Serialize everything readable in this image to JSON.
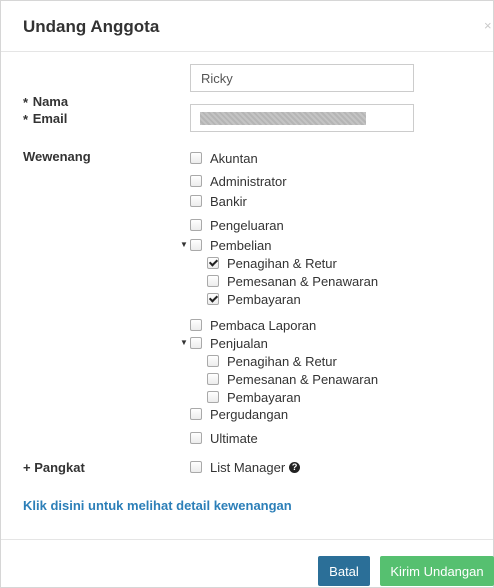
{
  "modal": {
    "title": "Undang Anggota",
    "close_glyph": "×"
  },
  "form": {
    "name_label": "Nama",
    "name_value": "Ricky",
    "email_label": "Email",
    "email_value_redacted": true,
    "required_mark": "*",
    "permissions_label": "Wewenang",
    "rank_label": "+ Pangkat"
  },
  "permissions": [
    {
      "label": "Akuntan",
      "checked": false
    },
    {
      "label": "Administrator",
      "checked": false
    },
    {
      "label": "Bankir",
      "checked": false
    },
    {
      "label": "Pengeluaran",
      "checked": false
    },
    {
      "label": "Pembelian",
      "checked": false,
      "expanded": true,
      "children": [
        {
          "label": "Penagihan & Retur",
          "checked": true
        },
        {
          "label": "Pemesanan & Penawaran",
          "checked": false
        },
        {
          "label": "Pembayaran",
          "checked": true
        }
      ]
    },
    {
      "label": "Pembaca Laporan",
      "checked": false
    },
    {
      "label": "Penjualan",
      "checked": false,
      "expanded": true,
      "children": [
        {
          "label": "Penagihan & Retur",
          "checked": false
        },
        {
          "label": "Pemesanan & Penawaran",
          "checked": false
        },
        {
          "label": "Pembayaran",
          "checked": false
        }
      ]
    },
    {
      "label": "Pergudangan",
      "checked": false
    },
    {
      "label": "Ultimate",
      "checked": false
    }
  ],
  "rank": {
    "option_label": "List Manager",
    "checked": false,
    "help_icon": "question-circle-icon"
  },
  "links": {
    "detail": "Klik disini untuk melihat detail kewenangan"
  },
  "footer": {
    "cancel_label": "Batal",
    "submit_label": "Kirim Undangan"
  },
  "colors": {
    "cancel_button": "#2b6f98",
    "submit_button": "#56c070",
    "link": "#2c7fb8"
  }
}
